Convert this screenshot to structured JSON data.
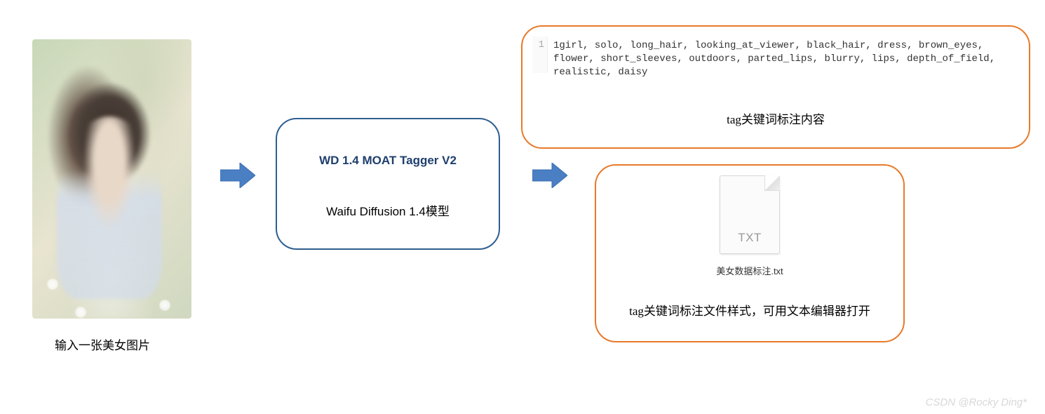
{
  "input": {
    "caption": "输入一张美女图片"
  },
  "model": {
    "title": "WD 1.4 MOAT Tagger V2",
    "subtitle": "Waifu Diffusion 1.4模型"
  },
  "tag_output": {
    "line_number": "1",
    "tags": "1girl, solo, long_hair, looking_at_viewer, black_hair, dress, brown_eyes, flower, short_sleeves, outdoors, parted_lips, blurry, lips, depth_of_field, realistic, daisy",
    "caption": "tag关键词标注内容"
  },
  "file_output": {
    "ext_label": "TXT",
    "filename": "美女数据标注.txt",
    "caption": "tag关键词标注文件样式，可用文本编辑器打开"
  },
  "watermark": "CSDN @Rocky Ding*",
  "colors": {
    "model_border": "#2e5e8e",
    "output_border": "#e87a2a",
    "arrow_fill": "#4a7fc4"
  }
}
